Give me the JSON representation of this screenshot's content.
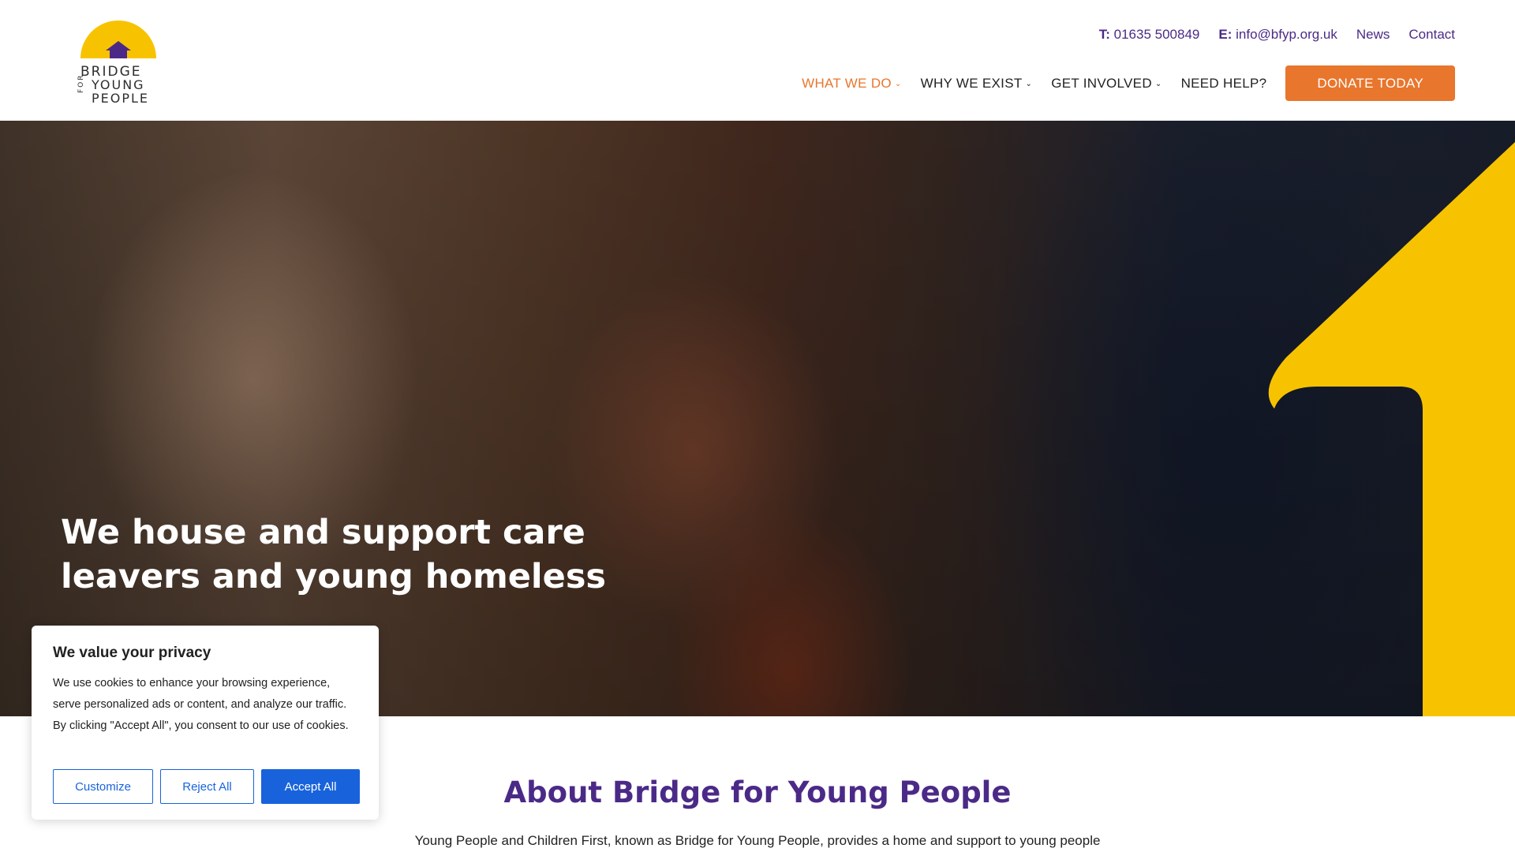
{
  "logo": {
    "line1": "BRIDGE",
    "line2": "FOR",
    "line3": "YOUNG",
    "line4": "PEOPLE"
  },
  "topbar": {
    "phone_label": "T:",
    "phone": "01635 500849",
    "email_label": "E:",
    "email": "info@bfyp.org.uk",
    "news": "News",
    "contact": "Contact"
  },
  "nav": {
    "items": [
      {
        "label": "WHAT WE DO",
        "active": true
      },
      {
        "label": "WHY WE EXIST",
        "active": false
      },
      {
        "label": "GET INVOLVED",
        "active": false
      },
      {
        "label": "NEED HELP?",
        "active": false
      }
    ],
    "donate": "DONATE TODAY"
  },
  "hero": {
    "title": "We house and support care leavers and young homeless"
  },
  "about": {
    "title": "About Bridge for Young People",
    "text": "Young People and Children First, known as Bridge for Young People, provides a home and support to young people"
  },
  "cookie": {
    "title": "We value your privacy",
    "body": "We use cookies to enhance your browsing experience, serve personalized ads or content, and analyze our traffic. By clicking \"Accept All\", you consent to our use of cookies.",
    "customize": "Customize",
    "reject": "Reject All",
    "accept": "Accept All"
  },
  "colors": {
    "brand_purple": "#4b2a87",
    "brand_orange": "#e8762c",
    "brand_yellow": "#f7c300",
    "cookie_blue": "#1863dc"
  },
  "icons": {
    "logo": "house-icon",
    "dropdown": "chevron-down-icon"
  }
}
